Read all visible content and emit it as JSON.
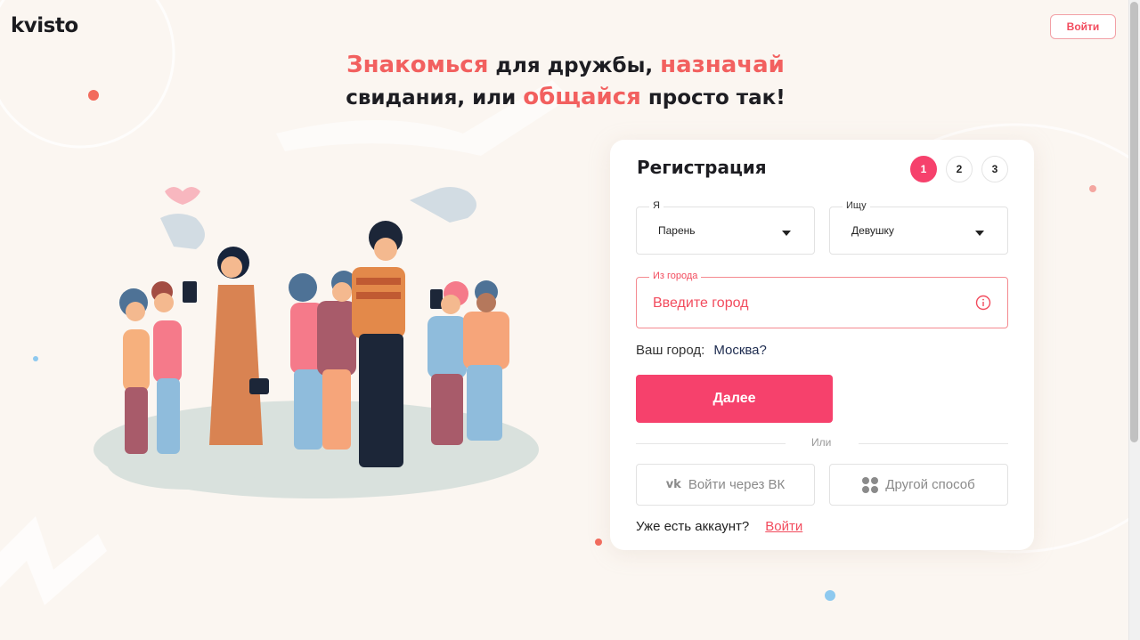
{
  "header": {
    "logo": "kvisto",
    "login_button": "Войти"
  },
  "headline": {
    "w1": "Знакомься",
    "t1": " для дружбы, ",
    "w2": "назначай",
    "t2": "свидания, или ",
    "w3": "общайся",
    "t3": " просто так!"
  },
  "registration": {
    "title": "Регистрация",
    "steps": [
      "1",
      "2",
      "3"
    ],
    "active_step": "1",
    "gender": {
      "label": "Я",
      "value": "Парень"
    },
    "seeking": {
      "label": "Ищу",
      "value": "Девушку"
    },
    "city": {
      "label": "Из города",
      "placeholder": "Введите город"
    },
    "your_city_label": "Ваш город:",
    "your_city_value": "Москва?",
    "next_button": "Далее",
    "or": "Или",
    "vk_icon": "vk",
    "vk_button": "Войти через ВК",
    "other_button": "Другой способ",
    "have_account": "Уже есть аккаунт?",
    "login_link": "Войти"
  },
  "colors": {
    "accent": "#f6416c",
    "headline_highlight": "#f2605f",
    "background": "#fbf6f1"
  }
}
